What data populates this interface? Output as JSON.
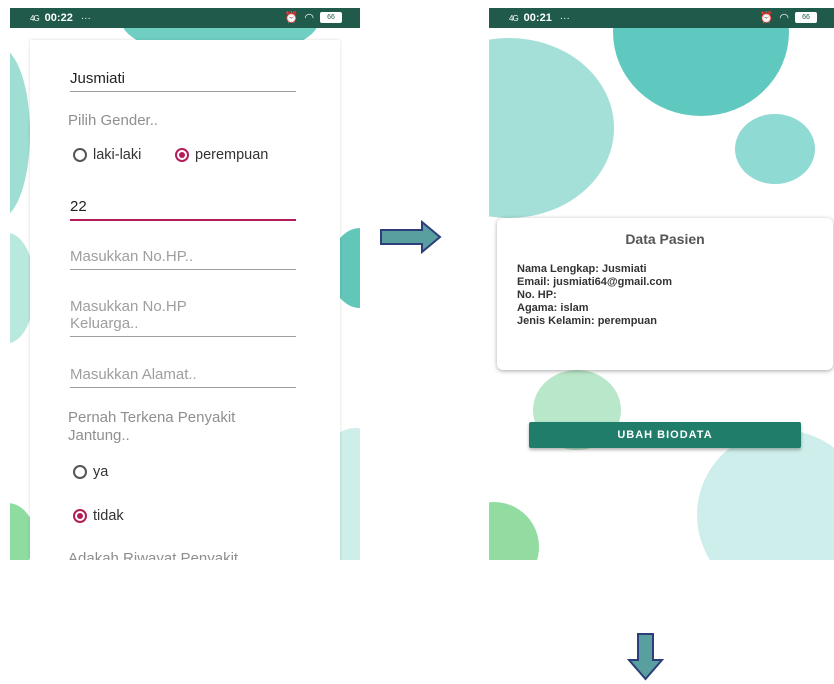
{
  "left_screen": {
    "status": {
      "signal": "4G",
      "time": "00:22",
      "more": "···",
      "battery": "66"
    },
    "name_value": "Jusmiati",
    "gender_label": "Pilih Gender..",
    "gender_options": [
      "laki-laki",
      "perempuan"
    ],
    "gender_selected": "perempuan",
    "age_value": "22",
    "phone_placeholder": "Masukkan No.HP..",
    "family_phone_placeholder": "Masukkan No.HP Keluarga..",
    "address_placeholder": "Masukkan Alamat..",
    "heart_label": "Pernah Terkena Penyakit Jantung..",
    "heart_options": [
      "ya",
      "tidak"
    ],
    "heart_selected": "tidak",
    "history_label": "Adakah Riwayat Penyakit"
  },
  "right_screen": {
    "status": {
      "signal": "4G",
      "time": "00:21",
      "more": "···",
      "battery": "66"
    },
    "card_title": "Data Pasien",
    "lines": {
      "name": "Nama Lengkap: Jusmiati",
      "email": "Email: jusmiati64@gmail.com",
      "phone": "No. HP:",
      "religion": "Agama: islam",
      "gender": "Jenis Kelamin: perempuan"
    },
    "button_label": "UBAH BIODATA"
  },
  "colors": {
    "accent": "#b21d5a",
    "status_bar": "#1f5a4a",
    "button": "#1f7d6a",
    "teal_circle": "#5fc9bf",
    "mint_circle": "#a8e0d8"
  },
  "icons": [
    "menu-icon",
    "home-icon",
    "back-icon",
    "arrow-right-icon",
    "arrow-down-icon",
    "wifi-icon",
    "alarm-icon",
    "battery-icon"
  ]
}
